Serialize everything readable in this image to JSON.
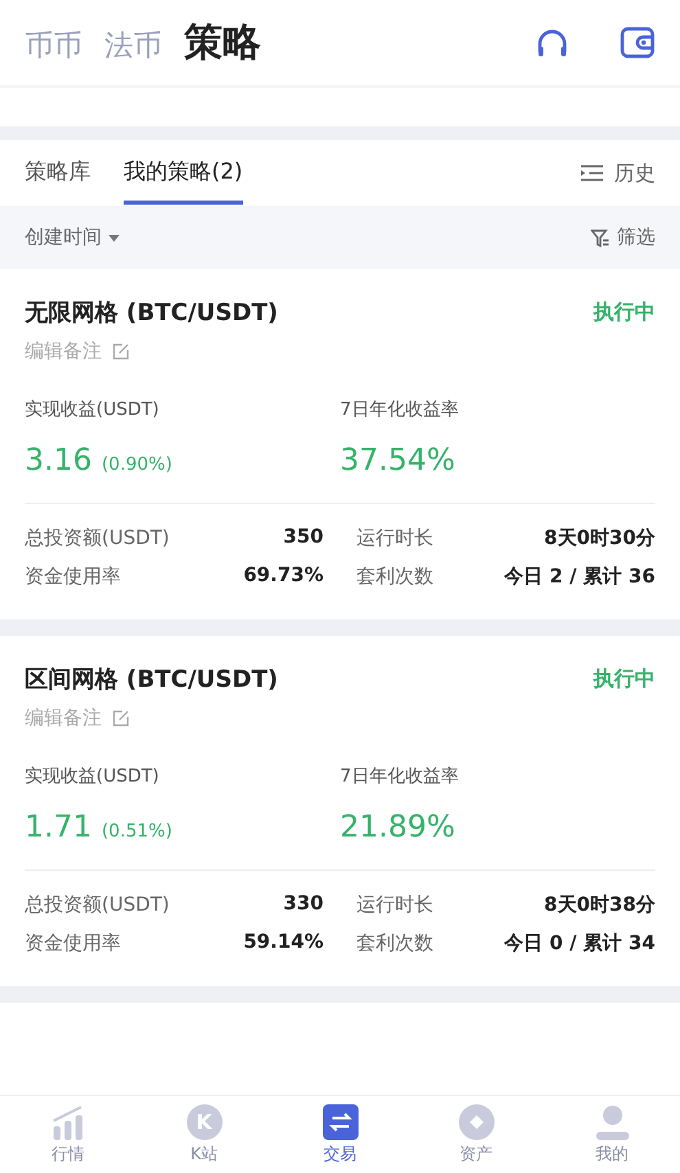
{
  "header_tabs": [
    {
      "label": "币币",
      "selected": false
    },
    {
      "label": "法币",
      "selected": false
    },
    {
      "label": "策略",
      "selected": true
    }
  ],
  "sub_tabs": [
    {
      "label": "策略库",
      "selected": false
    },
    {
      "label": "我的策略(2)",
      "selected": true
    }
  ],
  "history_link": "历史",
  "sort": {
    "label": "创建时间",
    "filter": "筛选"
  },
  "strategies": [
    {
      "name": "无限网格 (BTC/USDT)",
      "status": "执行中",
      "note": "编辑备注",
      "profit_label": "实现收益(USDT)",
      "profit": "3.16",
      "profit_pct": "(0.90%)",
      "apr_label": "7日年化收益率",
      "apr": "37.54%",
      "stats": [
        {
          "label": "总投资额(USDT)",
          "value": "350"
        },
        {
          "label": "运行时长",
          "value": "8天0时30分"
        },
        {
          "label": "资金使用率",
          "value": "69.73%"
        },
        {
          "label": "套利次数",
          "value": "今日 2 / 累计 36"
        }
      ]
    },
    {
      "name": "区间网格 (BTC/USDT)",
      "status": "执行中",
      "note": "编辑备注",
      "profit_label": "实现收益(USDT)",
      "profit": "1.71",
      "profit_pct": "(0.51%)",
      "apr_label": "7日年化收益率",
      "apr": "21.89%",
      "stats": [
        {
          "label": "总投资额(USDT)",
          "value": "330"
        },
        {
          "label": "运行时长",
          "value": "8天0时38分"
        },
        {
          "label": "资金使用率",
          "value": "59.14%"
        },
        {
          "label": "套利次数",
          "value": "今日 0 / 累计 34"
        }
      ]
    }
  ],
  "bottom_nav": [
    {
      "label": "行情",
      "kind": "chart",
      "selected": false
    },
    {
      "label": "K站",
      "kind": "letter",
      "letter": "K",
      "selected": false
    },
    {
      "label": "交易",
      "kind": "swap",
      "selected": true
    },
    {
      "label": "资产",
      "kind": "coin",
      "selected": false
    },
    {
      "label": "我的",
      "kind": "person",
      "selected": false
    }
  ]
}
